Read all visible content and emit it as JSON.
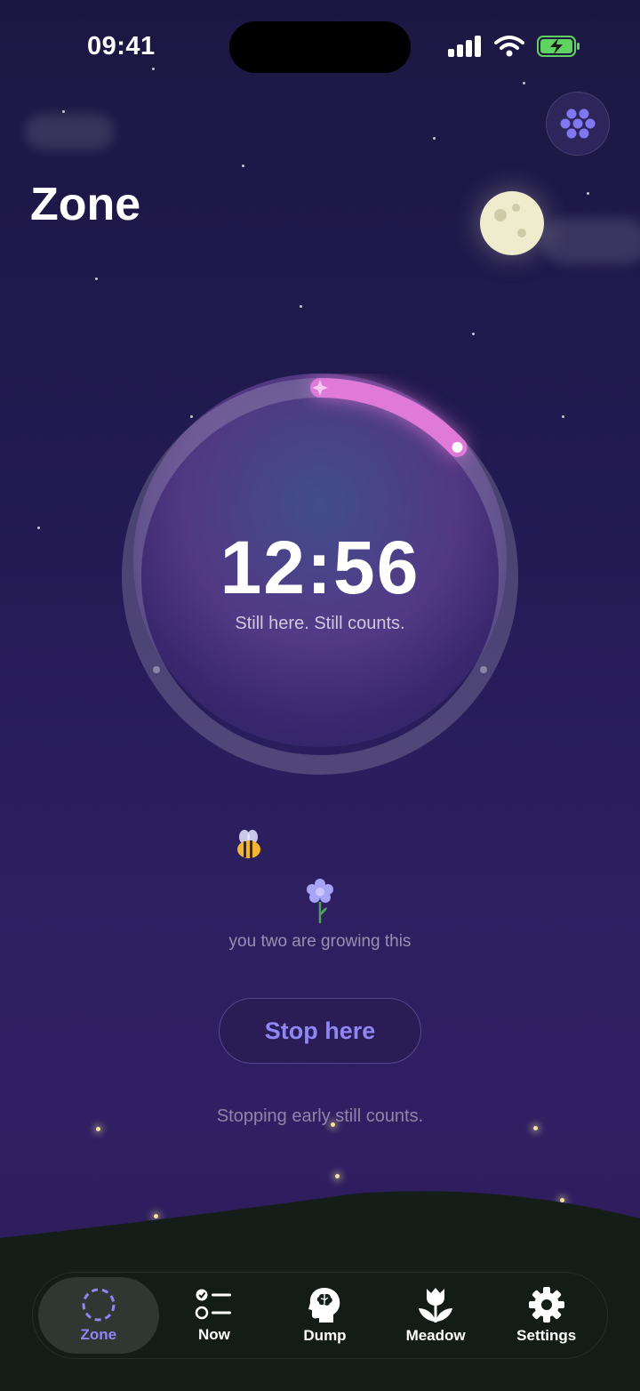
{
  "status_bar": {
    "time": "09:41"
  },
  "header": {
    "title": "Zone",
    "menu_icon": "flower-dots-icon"
  },
  "timer": {
    "time_remaining": "12:56",
    "subtitle": "Still here. Still counts.",
    "progress": 0.13,
    "accent_color": "#e07ad9"
  },
  "garden": {
    "caption": "you two are growing this"
  },
  "actions": {
    "stop_label": "Stop here",
    "stop_note": "Stopping early still counts."
  },
  "tabs": [
    {
      "label": "Zone",
      "icon": "dashed-circle-icon",
      "active": true
    },
    {
      "label": "Now",
      "icon": "checklist-icon",
      "active": false
    },
    {
      "label": "Dump",
      "icon": "brain-head-icon",
      "active": false
    },
    {
      "label": "Meadow",
      "icon": "tulip-icon",
      "active": false
    },
    {
      "label": "Settings",
      "icon": "gear-icon",
      "active": false
    }
  ],
  "colors": {
    "accent": "#8f86f5",
    "background": "#221a52"
  }
}
